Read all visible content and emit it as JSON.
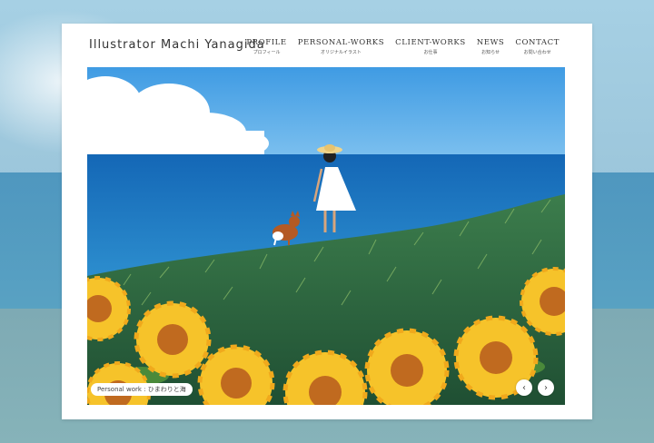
{
  "site": {
    "title": "Illustrator Machi Yanagida"
  },
  "nav": [
    {
      "en": "PROFILE",
      "ja": "プロフィール"
    },
    {
      "en": "PERSONAL-WORKS",
      "ja": "オリジナルイラスト"
    },
    {
      "en": "CLIENT-WORKS",
      "ja": "お仕事"
    },
    {
      "en": "NEWS",
      "ja": "お知らせ"
    },
    {
      "en": "CONTACT",
      "ja": "お問い合わせ"
    }
  ],
  "slider": {
    "caption": "Personal work : ひまわりと海",
    "prev_icon": "‹",
    "next_icon": "›"
  },
  "colors": {
    "sky": "#5aa6e6",
    "sea": "#1a76c2",
    "grass": "#2f6a43",
    "sunflower_petal": "#f6c32a",
    "sunflower_center": "#c06a1f"
  }
}
